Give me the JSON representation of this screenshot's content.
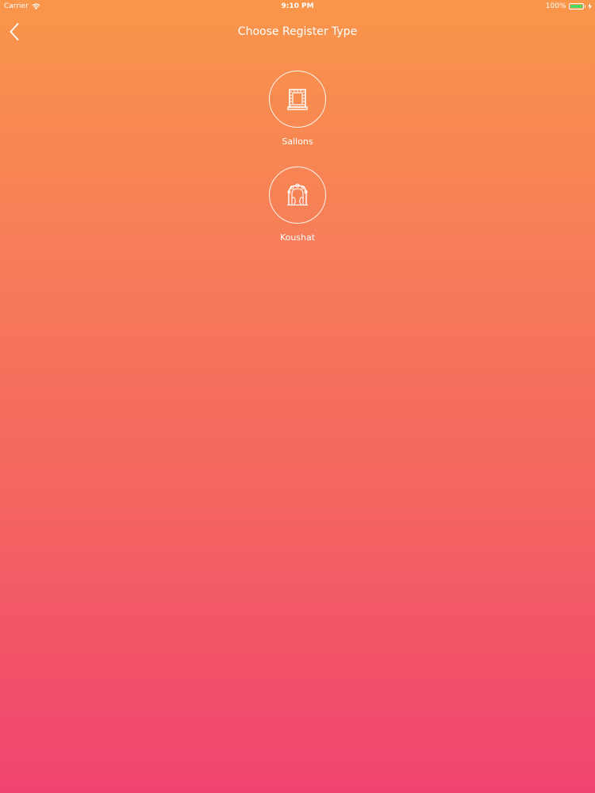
{
  "status_bar": {
    "carrier": "Carrier",
    "time": "9:10 PM",
    "battery_percent": "100%",
    "battery_level": 1.0
  },
  "nav": {
    "title": "Choose Register Type"
  },
  "options": [
    {
      "label": "Sallons",
      "icon": "mirror-icon"
    },
    {
      "label": "Koushat",
      "icon": "floral-arch-icon"
    }
  ],
  "colors": {
    "gradient_top": "#F9964A",
    "gradient_bottom": "#F04470",
    "text": "#FFFFFF",
    "battery": "#4CD964"
  }
}
